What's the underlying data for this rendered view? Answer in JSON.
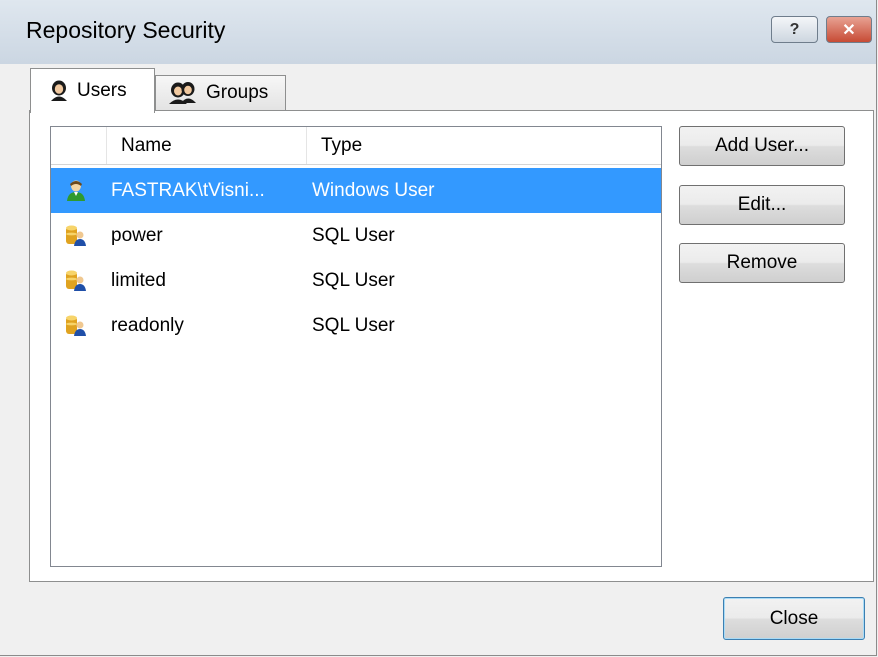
{
  "window": {
    "title": "Repository Security",
    "help_glyph": "?",
    "close_glyph": "✕"
  },
  "tabs": [
    {
      "label": "Users",
      "icon": "user-icon",
      "active": true
    },
    {
      "label": "Groups",
      "icon": "group-icon",
      "active": false
    }
  ],
  "list": {
    "columns": [
      "Name",
      "Type"
    ],
    "rows": [
      {
        "name": "FASTRAK\\tVisni...",
        "type": "Windows User",
        "icon": "windows-user-icon",
        "selected": true
      },
      {
        "name": "power",
        "type": "SQL User",
        "icon": "sql-user-icon",
        "selected": false
      },
      {
        "name": "limited",
        "type": "SQL User",
        "icon": "sql-user-icon",
        "selected": false
      },
      {
        "name": "readonly",
        "type": "SQL User",
        "icon": "sql-user-icon",
        "selected": false
      }
    ]
  },
  "buttons": {
    "add_user": "Add User...",
    "edit": "Edit...",
    "remove": "Remove",
    "close": "Close"
  },
  "colors": {
    "selection": "#3399ff",
    "window_bg": "#f0f0f0"
  }
}
